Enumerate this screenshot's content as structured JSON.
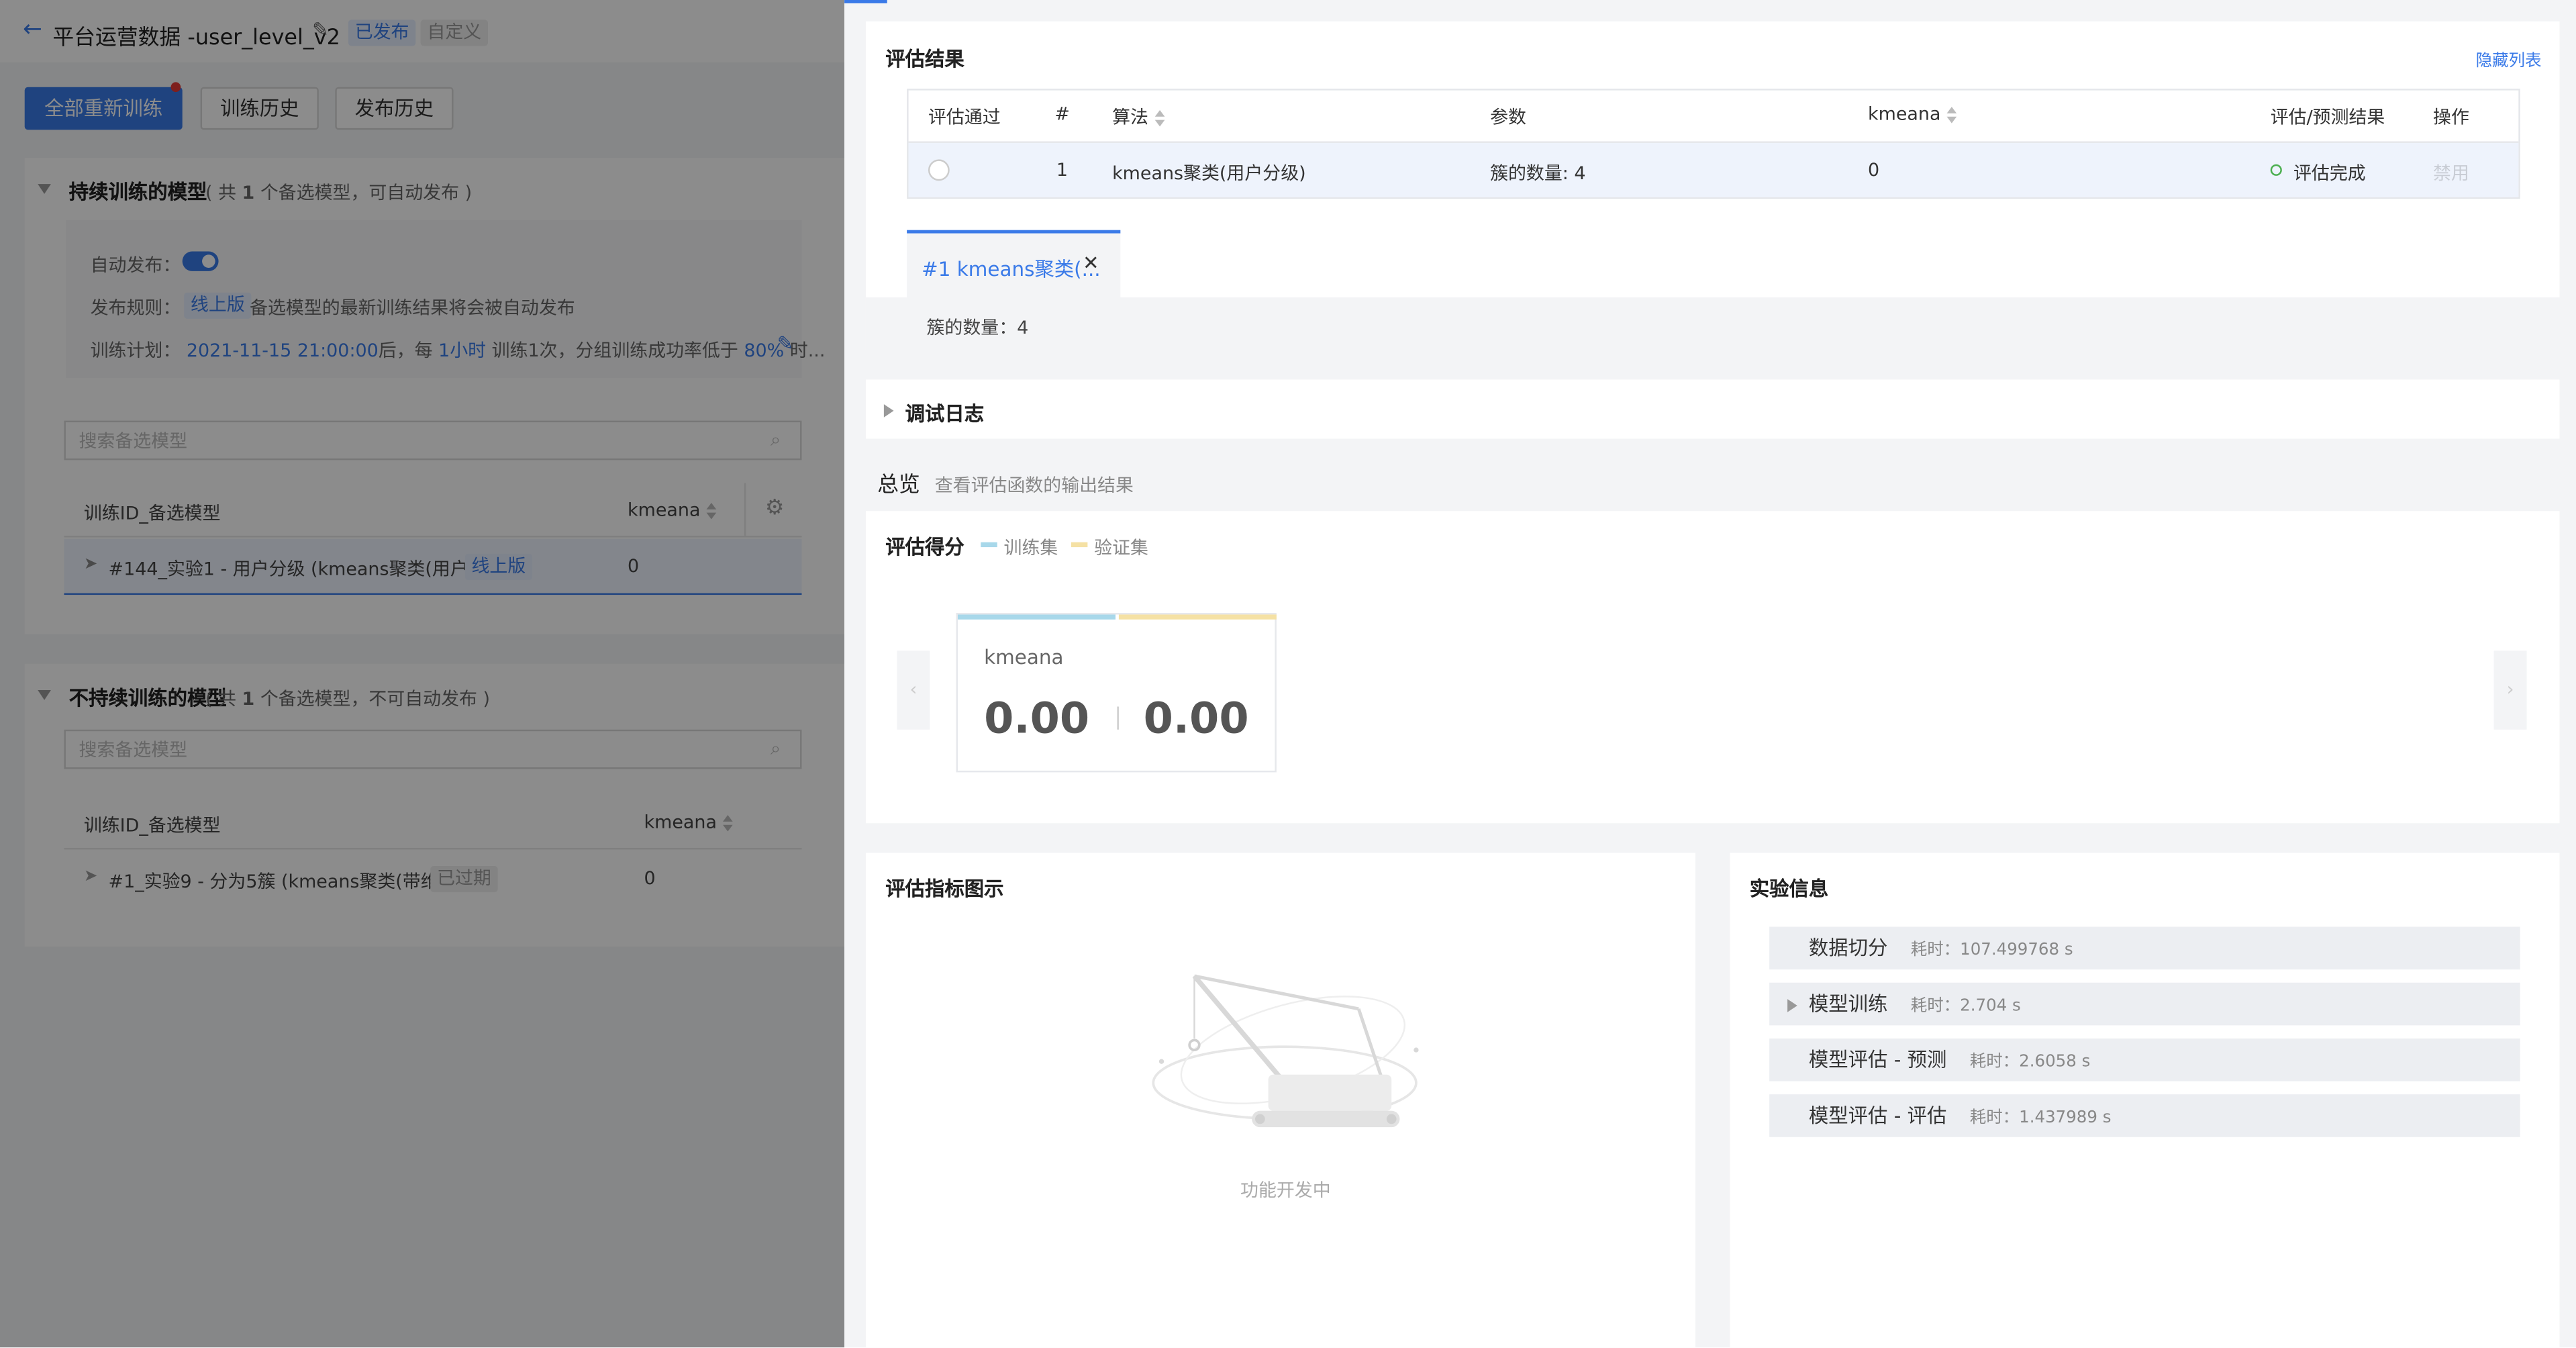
{
  "left_page": {
    "title": "平台运营数据 -user_level_v2",
    "status_published": "已发布",
    "status_custom": "自定义",
    "btn_retrain_all": "全部重新训练",
    "btn_train_history": "训练历史",
    "btn_publish_history": "发布历史",
    "continuous": {
      "title": "持续训练的模型",
      "note_prefix": "( 共 ",
      "note_count": "1",
      "note_suffix": " 个备选模型，可自动发布 )",
      "auto_publish_label": "自动发布：",
      "rule_label": "发布规则：",
      "rule_tag": "线上版",
      "rule_text": "备选模型的最新训练结果将会被自动发布",
      "plan_label": "训练计划：",
      "plan_date": "2021-11-15 21:00:00",
      "plan_mid1": "后，每",
      "plan_interval": "1小时",
      "plan_mid2": "训练1次，分组训练成功率低于",
      "plan_rate": "80%",
      "plan_tail": "时...",
      "search_placeholder": "搜索备选模型",
      "col_id": "训练ID_备选模型",
      "col_metric": "kmeana",
      "rows": [
        {
          "name": "#144_实验1 - 用户分级 (kmeans聚类(用户分级))",
          "tag": "线上版",
          "value": "0"
        }
      ]
    },
    "non_continuous": {
      "title": "不持续训练的模型",
      "note_prefix": "( 共 ",
      "note_count": "1",
      "note_suffix": " 个备选模型，不可自动发布 )",
      "search_placeholder": "搜索备选模型",
      "col_id": "训练ID_备选模型",
      "col_metric": "kmeana",
      "rows": [
        {
          "name": "#1_实验9 - 分为5簇 (kmeans聚类(带维度))",
          "tag": "已过期",
          "value": "0"
        }
      ]
    }
  },
  "drawer": {
    "eval_results": {
      "title": "评估结果",
      "hide_list": "隐藏列表",
      "headers": {
        "pass": "评估通过",
        "idx": "#",
        "algo": "算法",
        "params": "参数",
        "metric": "kmeana",
        "result": "评估/预测结果",
        "ops": "操作"
      },
      "rows": [
        {
          "idx": "1",
          "algo": "kmeans聚类(用户分级)",
          "params": "簇的数量: 4",
          "metric": "0",
          "result": "评估完成",
          "op": "禁用"
        }
      ],
      "tab_label": "#1 kmeans聚类(...",
      "tab_detail": "簇的数量：4"
    },
    "debug_log": {
      "title": "调试日志"
    },
    "overview": {
      "title": "总览",
      "subtitle": "查看评估函数的输出结果"
    },
    "eval_score": {
      "title": "评估得分",
      "legend_train": "训练集",
      "legend_valid": "验证集",
      "train_color": "#a8d8ea",
      "valid_color": "#f5e1a4",
      "metric_name": "kmeana",
      "train_value": "0.00",
      "valid_value": "0.00"
    },
    "metric_chart": {
      "title": "评估指标图示",
      "placeholder": "功能开发中"
    },
    "experiment_info": {
      "title": "实验信息",
      "steps": [
        {
          "name": "数据切分",
          "time": "耗时：107.499768 s",
          "expandable": false
        },
        {
          "name": "模型训练",
          "time": "耗时：2.704 s",
          "expandable": true
        },
        {
          "name": "模型评估 - 预测",
          "time": "耗时：2.6058 s",
          "expandable": false
        },
        {
          "name": "模型评估 - 评估",
          "time": "耗时：1.437989 s",
          "expandable": false
        }
      ]
    }
  }
}
